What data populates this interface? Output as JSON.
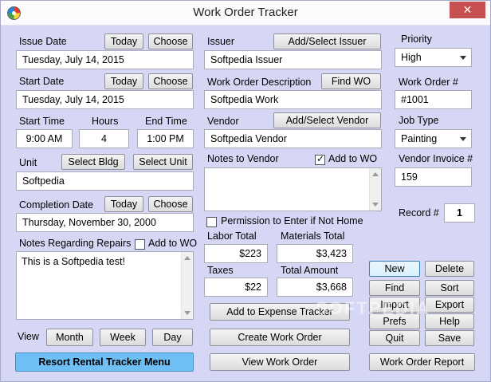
{
  "window": {
    "title": "Work Order Tracker",
    "close_glyph": "✕"
  },
  "issue_date": {
    "label": "Issue Date",
    "today": "Today",
    "choose": "Choose",
    "value": "Tuesday, July 14, 2015"
  },
  "start_date": {
    "label": "Start Date",
    "today": "Today",
    "choose": "Choose",
    "value": "Tuesday, July 14, 2015"
  },
  "times": {
    "start_label": "Start Time",
    "hours_label": "Hours",
    "end_label": "End Time",
    "start": "9:00 AM",
    "hours": "4",
    "end": "1:00 PM"
  },
  "unit": {
    "label": "Unit",
    "select_bldg": "Select Bldg",
    "select_unit": "Select Unit",
    "value": "Softpedia"
  },
  "completion": {
    "label": "Completion Date",
    "today": "Today",
    "choose": "Choose",
    "value": "Thursday, November 30, 2000"
  },
  "repairs": {
    "label": "Notes Regarding Repairs",
    "add_label": "Add to WO",
    "value": "This is a Softpedia test!"
  },
  "view": {
    "label": "View",
    "month": "Month",
    "week": "Week",
    "day": "Day"
  },
  "resort_button": "Resort Rental Tracker Menu",
  "issuer": {
    "label": "Issuer",
    "button": "Add/Select Issuer",
    "value": "Softpedia Issuer"
  },
  "description": {
    "label": "Work Order Description",
    "button": "Find WO",
    "value": "Softpedia Work"
  },
  "vendor": {
    "label": "Vendor",
    "button": "Add/Select Vendor",
    "value": "Softpedia Vendor"
  },
  "vendor_notes": {
    "label": "Notes to Vendor",
    "add_label": "Add to WO",
    "value": ""
  },
  "permission": {
    "label": "Permission to Enter if Not Home"
  },
  "costs": {
    "labor_label": "Labor Total",
    "labor": "$223",
    "materials_label": "Materials Total",
    "materials": "$3,423",
    "taxes_label": "Taxes",
    "taxes": "$22",
    "total_label": "Total Amount",
    "total": "$3,668"
  },
  "actions": {
    "expense": "Add to Expense Tracker",
    "create": "Create Work Order",
    "view": "View Work Order"
  },
  "priority": {
    "label": "Priority",
    "value": "High"
  },
  "work_order_no": {
    "label": "Work Order #",
    "value": "#1001"
  },
  "job_type": {
    "label": "Job Type",
    "value": "Painting"
  },
  "vendor_invoice": {
    "label": "Vendor Invoice #",
    "value": "159"
  },
  "record": {
    "label": "Record #",
    "value": "1"
  },
  "nav": {
    "new": "New",
    "delete": "Delete",
    "find": "Find",
    "sort": "Sort",
    "import": "Import",
    "export": "Export",
    "prefs": "Prefs",
    "help": "Help",
    "quit": "Quit",
    "save": "Save",
    "report": "Work Order Report"
  },
  "watermark": "SOFTPEDIA"
}
